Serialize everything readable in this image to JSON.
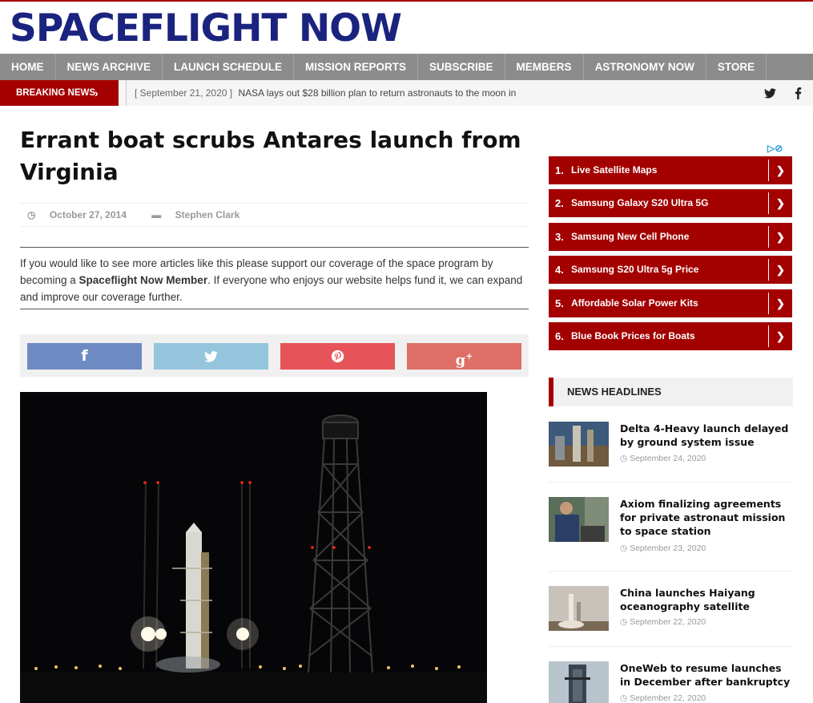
{
  "site": {
    "logo": "SPACEFLIGHT NOW"
  },
  "nav": [
    "HOME",
    "NEWS ARCHIVE",
    "LAUNCH SCHEDULE",
    "MISSION REPORTS",
    "SUBSCRIBE",
    "MEMBERS",
    "ASTRONOMY NOW",
    "STORE"
  ],
  "breaking": {
    "label": "BREAKING NEWS",
    "date": "[ September 21, 2020 ]",
    "text": "NASA lays out $28 billion plan to return astronauts to the moon in"
  },
  "article": {
    "title": "Errant boat scrubs Antares launch from Virginia",
    "date": "October 27, 2014",
    "author": "Stephen Clark",
    "support_pre": "If you would like to see more articles like this please support our coverage of the space program by becoming a ",
    "support_bold": "Spaceflight Now Member",
    "support_post": ". If everyone who enjoys our website helps fund it, we can expand and improve our coverage further."
  },
  "share": [
    {
      "icon": "facebook-icon",
      "glyph": "f",
      "color": "#6d8bc2"
    },
    {
      "icon": "twitter-icon",
      "glyph": "t",
      "color": "#95c5dd"
    },
    {
      "icon": "pinterest-icon",
      "glyph": "p",
      "color": "#e65359"
    },
    {
      "icon": "google-plus-icon",
      "glyph": "g+",
      "color": "#dd6f67"
    }
  ],
  "ads": [
    {
      "num": "1.",
      "label": "Live Satellite Maps"
    },
    {
      "num": "2.",
      "label": "Samsung Galaxy S20 Ultra 5G"
    },
    {
      "num": "3.",
      "label": "Samsung New Cell Phone"
    },
    {
      "num": "4.",
      "label": "Samsung S20 Ultra 5g Price"
    },
    {
      "num": "5.",
      "label": "Affordable Solar Power Kits"
    },
    {
      "num": "6.",
      "label": "Blue Book Prices for Boats"
    }
  ],
  "headlines": {
    "heading": "NEWS HEADLINES",
    "items": [
      {
        "title": "Delta 4-Heavy launch delayed by ground system issue",
        "date": "September 24, 2020"
      },
      {
        "title": "Axiom finalizing agreements for private astronaut mission to space station",
        "date": "September 23, 2020"
      },
      {
        "title": "China launches Haiyang oceanography satellite",
        "date": "September 22, 2020"
      },
      {
        "title": "OneWeb to resume launches in December after bankruptcy",
        "date": "September 22, 2020"
      }
    ]
  },
  "colors": {
    "brand_red": "#a50000",
    "logo_blue": "#1a237e",
    "nav_gray": "#8c8c8c",
    "ad_red": "#a30000"
  }
}
